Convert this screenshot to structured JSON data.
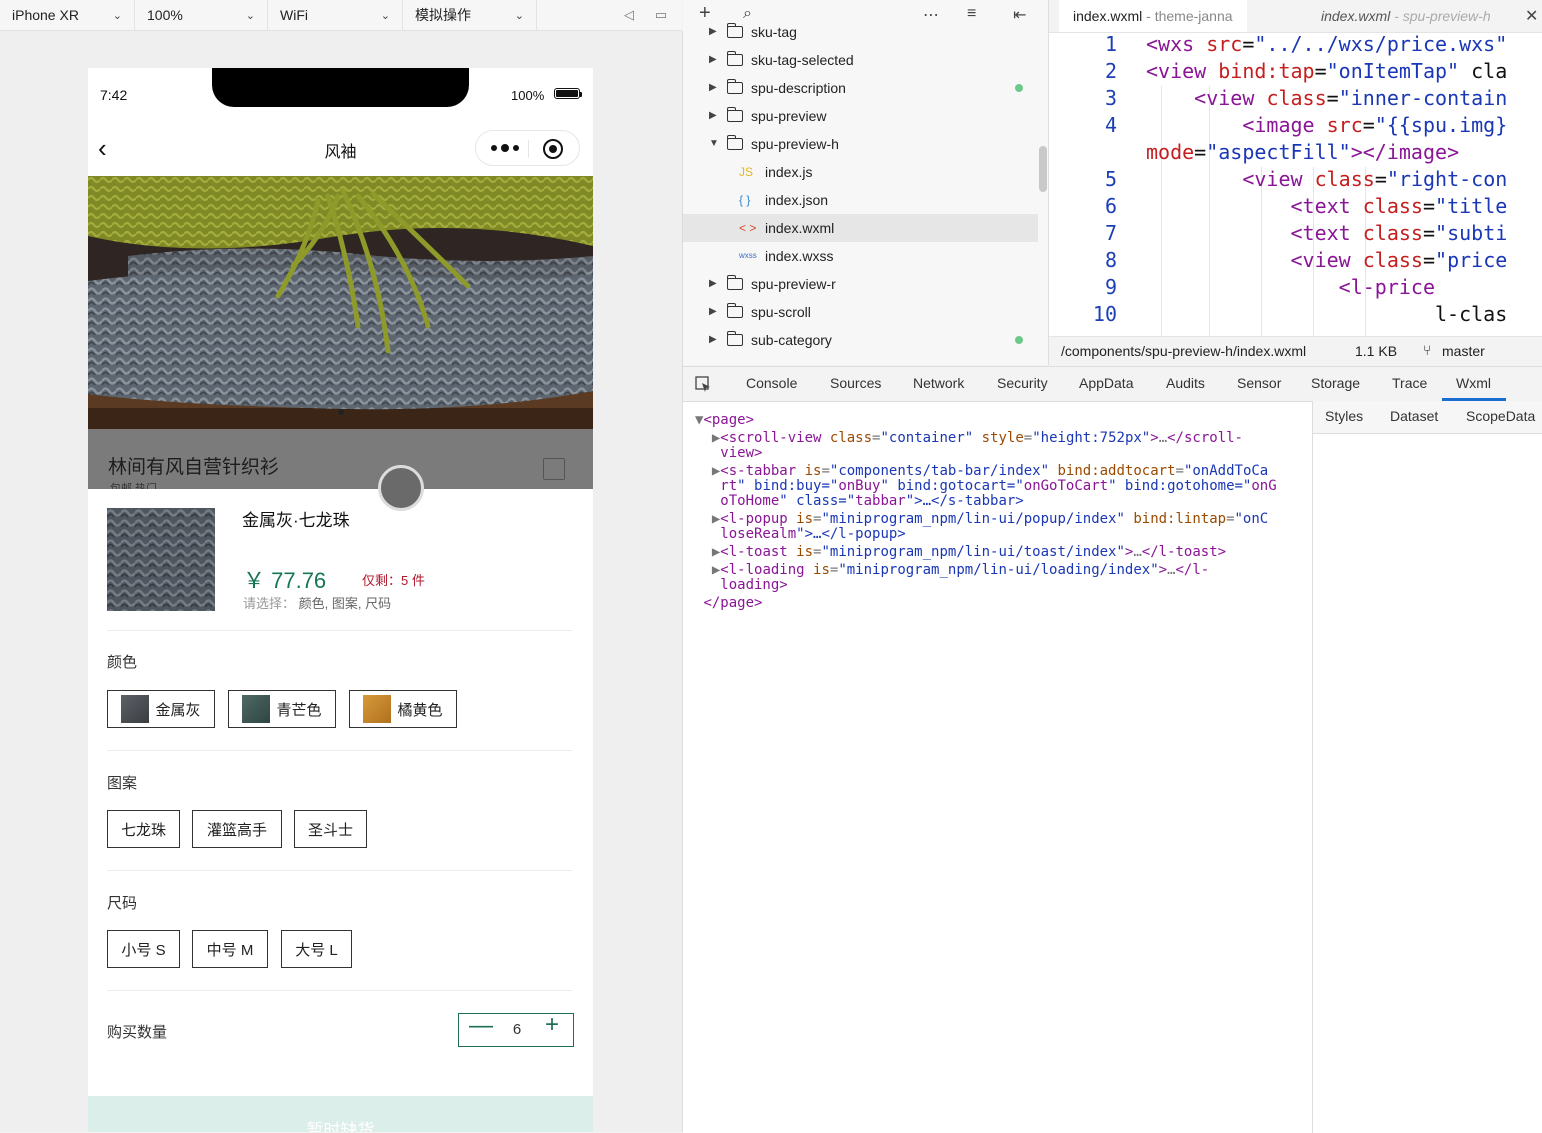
{
  "simulator_toolbar": {
    "device": "iPhone XR",
    "zoom": "100%",
    "network": "WiFi",
    "mode": "模拟操作"
  },
  "phone": {
    "status": {
      "time": "7:42",
      "battery": "100%"
    },
    "nav": {
      "title": "风袖"
    },
    "hero": {
      "caption": "林间有风自营针织衫",
      "caption_sub": "包邮 热门"
    },
    "product": {
      "name": "金属灰·七龙珠",
      "price": "￥ 77.76",
      "stock": "仅剩：5 件",
      "select_hint_key": "请选择：",
      "select_hint_value": "颜色, 图案, 尺码"
    },
    "sections": [
      {
        "title": "颜色",
        "options": [
          "金属灰",
          "青芒色",
          "橘黄色"
        ]
      },
      {
        "title": "图案",
        "options": [
          "七龙珠",
          "灌篮高手",
          "圣斗士"
        ]
      },
      {
        "title": "尺码",
        "options": [
          "小号 S",
          "中号 M",
          "大号 L"
        ]
      }
    ],
    "quantity": {
      "label": "购买数量",
      "value": "6",
      "minus": "—",
      "plus": "+"
    },
    "buy_button": "暂时缺货"
  },
  "file_tree": {
    "rows": [
      {
        "name": "sku-tag",
        "type": "folder",
        "expanded": false
      },
      {
        "name": "sku-tag-selected",
        "type": "folder",
        "expanded": false
      },
      {
        "name": "spu-description",
        "type": "folder",
        "expanded": false,
        "modified": true
      },
      {
        "name": "spu-preview",
        "type": "folder",
        "expanded": false
      },
      {
        "name": "spu-preview-h",
        "type": "folder",
        "expanded": true
      },
      {
        "name": "index.js",
        "type": "js",
        "icon_text": "JS"
      },
      {
        "name": "index.json",
        "type": "json",
        "icon_text": "{ }"
      },
      {
        "name": "index.wxml",
        "type": "wxml",
        "icon_text": "< >",
        "selected": true
      },
      {
        "name": "index.wxss",
        "type": "wxss",
        "icon_text": "wxss"
      },
      {
        "name": "spu-preview-r",
        "type": "folder",
        "expanded": false
      },
      {
        "name": "spu-scroll",
        "type": "folder",
        "expanded": false
      },
      {
        "name": "sub-category",
        "type": "folder",
        "expanded": false,
        "modified": true
      }
    ]
  },
  "editor": {
    "tabs": [
      {
        "file": "index.wxml",
        "project": " - theme-janna"
      },
      {
        "file": "index.wxml",
        "project": " - spu-preview-h"
      }
    ],
    "lines": [
      {
        "n": "1",
        "text": "<wxs src=\"../../wxs/price.wxs\""
      },
      {
        "n": "2",
        "text": "<view bind:tap=\"onItemTap\" cla"
      },
      {
        "n": "3",
        "text": "    <view class=\"inner-contain"
      },
      {
        "n": "4",
        "text": "        <image src=\"{{spu.img}"
      },
      {
        "n": "",
        "text": "mode=\"aspectFill\"></image>"
      },
      {
        "n": "5",
        "text": "        <view class=\"right-con"
      },
      {
        "n": "6",
        "text": "            <text class=\"title"
      },
      {
        "n": "7",
        "text": "            <text class=\"subti"
      },
      {
        "n": "8",
        "text": "            <view class=\"price"
      },
      {
        "n": "9",
        "text": "                <l-price"
      },
      {
        "n": "10",
        "text": "                        l-clas"
      }
    ],
    "status": {
      "path": "/components/spu-preview-h/index.wxml",
      "size": "1.1 KB",
      "branch": "master"
    }
  },
  "devtools": {
    "tabs": [
      "Console",
      "Sources",
      "Network",
      "Security",
      "AppData",
      "Audits",
      "Sensor",
      "Storage",
      "Trace",
      "Wxml"
    ],
    "active_tab": "Wxml",
    "side_tabs": [
      "Styles",
      "Dataset",
      "ScopeData"
    ],
    "dom_lines": [
      "▼<page>",
      "  ▶<scroll-view class=\"container\" style=\"height:752px\">…</scroll-",
      "   view>",
      "  ▶<s-tabbar is=\"components/tab-bar/index\" bind:addtocart=\"onAddToCa",
      "   rt\" bind:buy=\"onBuy\" bind:gotocart=\"onGoToCart\" bind:gotohome=\"onG",
      "   oToHome\" class=\"tabbar\">…</s-tabbar>",
      "  ▶<l-popup is=\"miniprogram_npm/lin-ui/popup/index\" bind:lintap=\"onC",
      "   loseRealm\">…</l-popup>",
      "  ▶<l-toast is=\"miniprogram_npm/lin-ui/toast/index\">…</l-toast>",
      "  ▶<l-loading is=\"miniprogram_npm/lin-ui/loading/index\">…</l-",
      "   loading>",
      " </page>"
    ]
  },
  "colors": {
    "accent_green": "#157658",
    "stock_red": "#b3192b",
    "wxml_underline": "#1a6ecf"
  }
}
